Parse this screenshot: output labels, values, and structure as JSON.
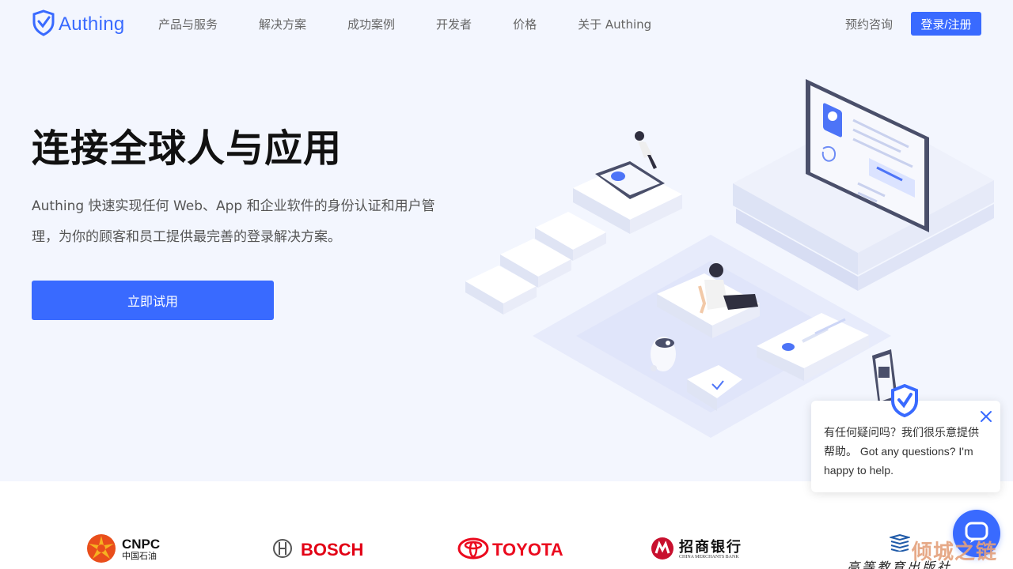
{
  "nav": {
    "brand": "Authing",
    "items": [
      {
        "label": "产品与服务"
      },
      {
        "label": "解决方案"
      },
      {
        "label": "成功案例"
      },
      {
        "label": "开发者"
      },
      {
        "label": "价格"
      },
      {
        "label": "关于 Authing"
      }
    ],
    "consult_label": "预约咨询",
    "login_label": "登录/注册"
  },
  "hero": {
    "title": "连接全球人与应用",
    "description": "Authing 快速实现任何 Web、App 和企业软件的身份认证和用户管理，为你的顾客和员工提供最完善的登录解决方案。",
    "cta_label": "立即试用"
  },
  "clients": {
    "cnpc_en": "CNPC",
    "cnpc_cn": "中国石油",
    "bosch": "BOSCH",
    "toyota": "TOYOTA",
    "cmb_cn": "招商银行",
    "cmb_en": "CHINA MERCHANTS BANK",
    "hep_cn": "高等教育出版社"
  },
  "chat": {
    "message": "有任何疑问吗？我们很乐意提供帮助。 Got any questions? I'm happy to help."
  },
  "watermark": "倾城之链",
  "colors": {
    "brand": "#396aff",
    "hero_bg": "#f3f6fe",
    "bosch_red": "#e20015",
    "toyota_red": "#eb0a1e",
    "cnpc_orange": "#e94e1b"
  },
  "icons": {
    "logo": "shield-check-icon",
    "close": "close-icon",
    "launcher": "chat-bubble-icon"
  }
}
